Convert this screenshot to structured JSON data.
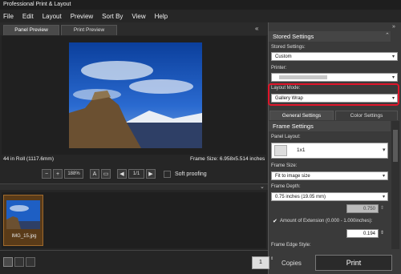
{
  "app": {
    "title": "Professional Print & Layout"
  },
  "menu": [
    "File",
    "Edit",
    "Layout",
    "Preview",
    "Sort By",
    "View",
    "Help"
  ],
  "tabs": {
    "panel_preview": "Panel Preview",
    "print_preview": "Print Preview"
  },
  "preview": {
    "roll_info": "44 in Roll (1117.6mm)",
    "frame_size": "Frame Size: 6.958x5.514 inches"
  },
  "toolbar": {
    "zoom": "188%",
    "page": "1/1",
    "soft_proofing": "Soft proofing"
  },
  "film": {
    "thumb_name": "IMG_15.jpg"
  },
  "bottom": {
    "copies_value": "1",
    "copies_label": "Copies",
    "print_label": "Print"
  },
  "right": {
    "stored_settings_header": "Stored Settings",
    "stored_settings_label": "Stored Settings:",
    "stored_settings_value": "Custom",
    "printer_label": "Printer:",
    "layout_mode_label": "Layout Mode:",
    "layout_mode_value": "Gallery Wrap",
    "tab_general": "General Settings",
    "tab_color": "Color Settings",
    "frame_settings_header": "Frame Settings",
    "panel_layout_label": "Panel Layout:",
    "panel_layout_value": "1x1",
    "frame_size_label": "Frame Size:",
    "frame_size_value": "Fit to image size",
    "frame_depth_label": "Frame Depth:",
    "frame_depth_value": "0.75 inches (19.05 mm)",
    "depth_number": "0.750",
    "extension_label": "Amount of Extension (0.000 - 1.000inches):",
    "extension_value": "0.194",
    "edge_style_label": "Frame Edge Style:"
  },
  "colors": {
    "highlight": "#e0152a",
    "accent": "#1e6fd9"
  }
}
